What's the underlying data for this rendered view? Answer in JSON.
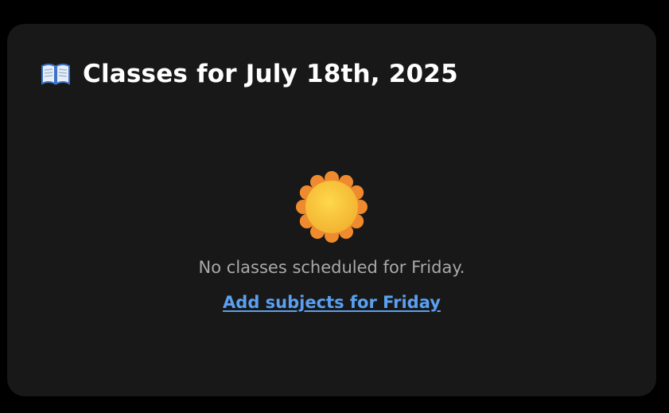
{
  "card": {
    "title": "Classes for July 18th, 2025",
    "title_icon": "open-book-icon",
    "empty_state": {
      "icon": "sun-icon",
      "message": "No classes scheduled for Friday.",
      "action_label": "Add subjects for Friday"
    }
  },
  "colors": {
    "page_background": "#000000",
    "card_background": "#181818",
    "title_text": "#ffffff",
    "muted_text": "#a9a9a9",
    "link": "#5aa0f0",
    "sun_outer": "#f08a2e",
    "sun_inner": "#fcc93a"
  }
}
